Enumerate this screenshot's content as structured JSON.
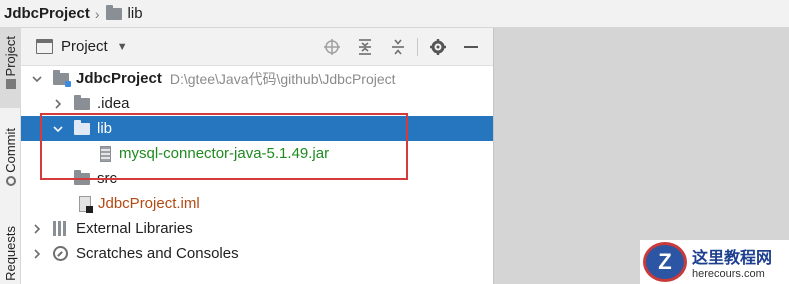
{
  "breadcrumb": {
    "project": "JdbcProject",
    "folder": "lib"
  },
  "stripe": {
    "project": "Project",
    "commit": "Commit",
    "requests": "Requests"
  },
  "panel": {
    "title": "Project"
  },
  "tree": {
    "root": {
      "name": "JdbcProject",
      "path": "D:\\gtee\\Java代码\\github\\JdbcProject"
    },
    "idea": ".idea",
    "lib": "lib",
    "jar": "mysql-connector-java-5.1.49.jar",
    "src": "src",
    "iml": "JdbcProject.iml",
    "external": "External Libraries",
    "scratches": "Scratches and Consoles"
  },
  "watermark": {
    "logo": "Z",
    "cn": "这里教程网",
    "url": "herecours.com"
  }
}
